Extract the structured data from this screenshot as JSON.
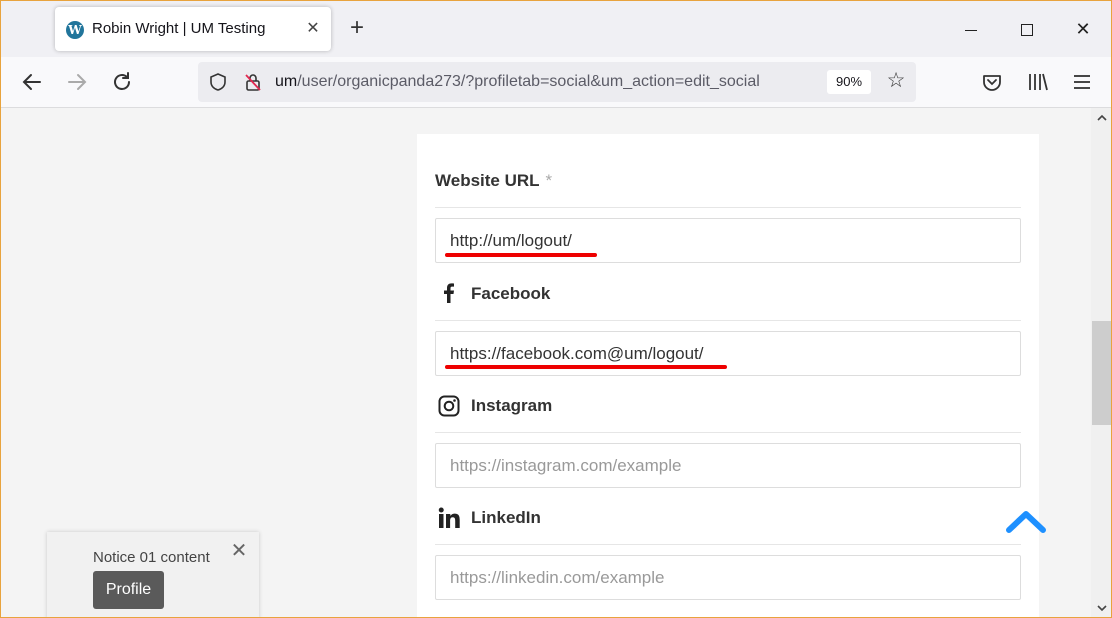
{
  "browser": {
    "tab": {
      "title": "Robin Wright | UM Testing",
      "favicon": "wordpress-icon"
    },
    "new_tab_label": "+",
    "url": {
      "host": "um",
      "path": "/user/organicpanda273/?profiletab=social&um_action=edit_social"
    },
    "zoom": "90%"
  },
  "form": {
    "website": {
      "label": "Website URL",
      "required_mark": "*",
      "value": "http://um/logout/",
      "icon": ""
    },
    "facebook": {
      "label": "Facebook",
      "icon": "facebook-icon",
      "value": "https://facebook.com@um/logout/"
    },
    "instagram": {
      "label": "Instagram",
      "icon": "instagram-icon",
      "placeholder": "https://instagram.com/example"
    },
    "linkedin": {
      "label": "LinkedIn",
      "icon": "linkedin-icon",
      "placeholder": "https://linkedin.com/example"
    }
  },
  "notice": {
    "text": "Notice 01 content",
    "button_label": "Profile"
  },
  "colors": {
    "annotation_underline": "#e00000",
    "back_to_top": "#1e90ff",
    "notice_button": "#5a5a5a"
  }
}
